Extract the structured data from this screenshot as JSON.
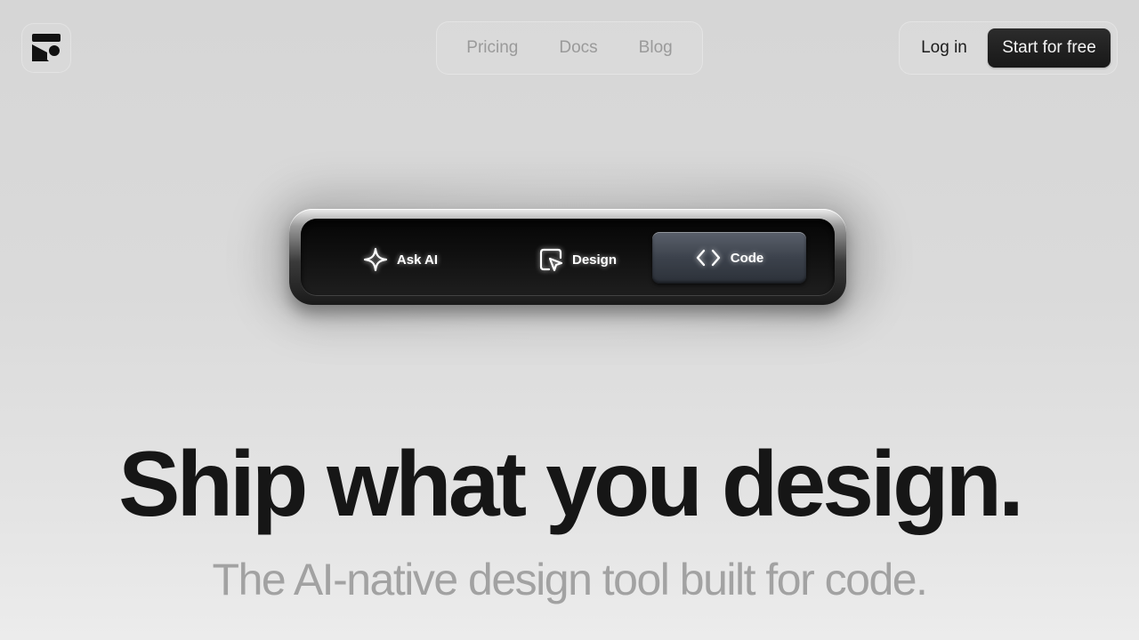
{
  "header": {
    "logo_icon": "brand-logo-icon",
    "nav": [
      {
        "label": "Pricing"
      },
      {
        "label": "Docs"
      },
      {
        "label": "Blog"
      }
    ],
    "login_label": "Log in",
    "cta_label": "Start for free"
  },
  "toolbar": {
    "items": [
      {
        "label": "Ask AI",
        "icon": "sparkle-icon",
        "active": false
      },
      {
        "label": "Design",
        "icon": "cursor-frame-icon",
        "active": false
      },
      {
        "label": "Code",
        "icon": "code-brackets-icon",
        "active": true
      }
    ]
  },
  "hero": {
    "headline": "Ship what you design.",
    "subheadline": "The AI-native design tool built for code."
  },
  "colors": {
    "cta_bg": "#1e1e1e",
    "headline": "#161616",
    "subheadline": "#a2a2a2",
    "nav_link": "#9a9a9a"
  }
}
